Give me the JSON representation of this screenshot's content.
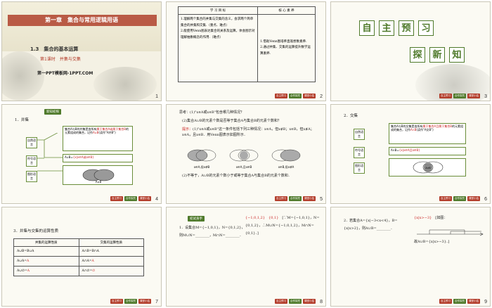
{
  "s1": {
    "chapter": "第一章　集合与常用逻辑用语",
    "section": "1.3　集合的基本运算",
    "lesson": "第1课时　并集与交集",
    "logo": "第一PPT模板网-1PPT.COM",
    "num": "1"
  },
  "s2": {
    "headers": [
      "学 习 目 标",
      "核 心 素 养"
    ],
    "goals": "1.理解两个集合的并集与交集的含义，会求两个简单集合的并集和交集.（重点、难点）\n2.能使用Venn图表达集合的关系及运算，体会图示对理解抽象概念的作用.（难点）",
    "literacy": "1.借助Venn图培养直观想象素养.\n2.通过并集、交集的运算提升数学运算素养.",
    "num": "2"
  },
  "s3": {
    "title1": [
      "自",
      "主",
      "预",
      "习"
    ],
    "title2": [
      "探",
      "新",
      "知"
    ],
    "num": "3"
  },
  "s4": {
    "tag": "新知初探",
    "heading": "1．并集",
    "def_pre": "集合A与B的并集是由所有",
    "def_red1": "属于集合A或属于集合B",
    "def_mid": "的元素组成的集合，记作",
    "def_red2": "A∪B",
    "def_post": "(读作\"A并B\")",
    "labels": [
      "自然语言",
      "符号语言",
      "图形语言"
    ],
    "symbolic": "A∪B=",
    "symbolic_red": "{x|x∈A或x∈B}",
    "venn_label": "A∪B",
    "num": "4"
  },
  "s5": {
    "q1": "思考：(1)\"x∈A或x∈B\"包含哪几种情况？",
    "q2": "(2)集合A∪B的元素个数是否等于集合A与集合B的元素个数和？",
    "hint_label": "提示：",
    "hint_text": "(1)\"x∈A或x∈B\"这一条件包括下列三种情况：x∈A，但x∉B；x∈B，但x∉A；x∈A，且x∈B．用Venn图表示如图所示．",
    "venn_labels": [
      "x∈A,但x∉B",
      "x∈A,且x∈B",
      "x∈B,但x∉A"
    ],
    "answer2": "(2)不等于，A∪B的元素个数小于或等于集合A与集合B的元素个数和．",
    "num": "5"
  },
  "s6": {
    "heading": "2．交集",
    "def_pre": "集合A与B的交集是由所有",
    "def_red1": "属于集合A且属于集合B",
    "def_mid": "的元素组成的集合，记作",
    "def_red2": "A∩B",
    "def_post": "(读作\"A交B\")",
    "labels": [
      "自然语言",
      "符号语言",
      "图形语言"
    ],
    "symbolic": "A∩B=",
    "symbolic_red": "{x|x∈A且x∈B}",
    "venn_label": "A∩B",
    "num": "6"
  },
  "s7": {
    "heading": "3．并集与交集的运算性质",
    "headers": [
      "并集的运算性质",
      "交集的运算性质"
    ],
    "rows": [
      [
        "A∪B=B∪A",
        "A∩B=B∩A"
      ],
      [
        "A∪A=",
        "A",
        "A∩A=",
        "A"
      ],
      [
        "A∪∅=",
        "A",
        "A∩∅=",
        "∅"
      ]
    ],
    "num": "7"
  },
  "s8": {
    "tag": "初试身手",
    "q": "1．设集合M={−1,0,1}，N={0,1,2}，则M∪N=________，M∩N=________．",
    "ans_red1": "{−1,0,1,2}",
    "ans_red2": "{0,1}",
    "ans_text": "[∵M={−1,0,1}，N={0,1,2}，∴M∪N={−1,0,1,2}，M∩N={0,1}．]",
    "num": "8"
  },
  "s9": {
    "q": "2．若集合A={x|−3<x<4}，B={x|x>2}，则A∪B=________．",
    "ans_red": "{x|x>−3}",
    "ans_text": "[如图：",
    "ans_text2": "故A∪B={x|x>−3}．]",
    "num": "9"
  },
  "nav": [
    "自主预习",
    "合作探究",
    "课堂小结"
  ]
}
